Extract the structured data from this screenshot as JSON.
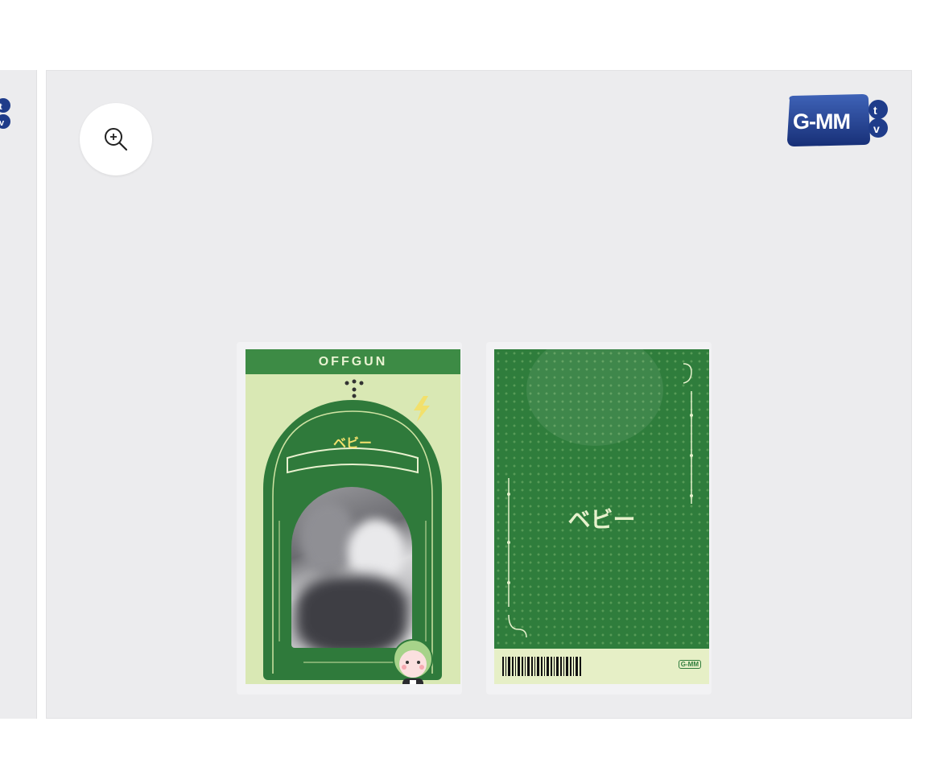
{
  "brand": {
    "logo_text": "G-MM",
    "logo_badge": "tv",
    "color_primary": "#1f3c8a"
  },
  "gallery": {
    "zoom_icon": "zoom-in-icon"
  },
  "product": {
    "front_header": "OFFGUN",
    "front_title": "ベビー",
    "back_title": "ベビー",
    "colors": {
      "card_green": "#2f7d3c",
      "card_light": "#d9e8b4",
      "background": "#ececee"
    }
  }
}
